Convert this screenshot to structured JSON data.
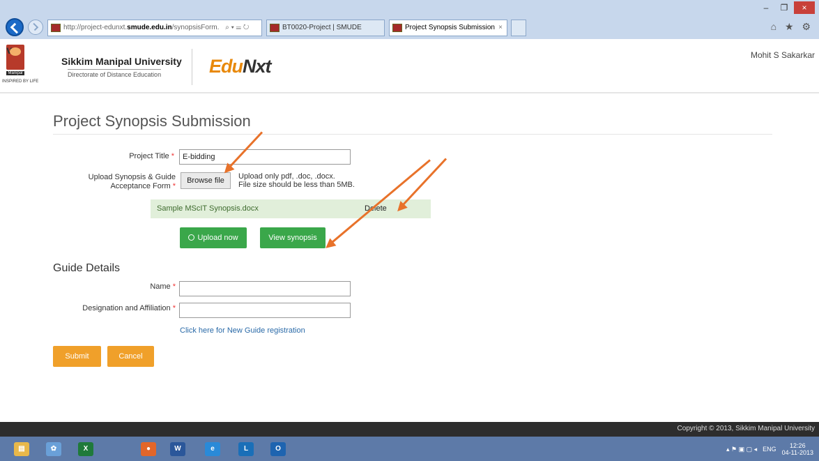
{
  "browser": {
    "address_prefix": "http://project-edunxt.",
    "address_host": "smude.edu.in",
    "address_suffix": "/synopsisForm.",
    "address_controls": "⌕ ▾ ☰ ↻",
    "tabs": [
      {
        "label": "BT0020-Project | SMUDE"
      },
      {
        "label": "Project Synopsis Submission"
      }
    ],
    "tab_close": "×",
    "window_minimize": "–",
    "window_restore": "❐",
    "window_close": "×",
    "toolbar_icons": "⌂ ★ ⚙"
  },
  "header": {
    "logo_label": "Manipal",
    "tagline": "INSPIRED BY LIFE",
    "university": "Sikkim Manipal University",
    "subtitle": "Directorate of Distance Education",
    "brand_prefix": "Edu",
    "brand_suffix": "Nxt",
    "user": "Mohit S Sakarkar"
  },
  "form": {
    "page_title": "Project Synopsis Submission",
    "project_title_label": "Project Title",
    "project_title_value": "E-bidding",
    "upload_label_line1": "Upload Synopsis & Guide",
    "upload_label_line2": "Acceptance Form",
    "required_mark": "*",
    "browse_label": "Browse file",
    "upload_note_line1": "Upload only pdf, .doc, .docx.",
    "upload_note_line2": "File size should be less than 5MB.",
    "file_name": "Sample MScIT Synopsis.docx",
    "delete_label": "Delete",
    "upload_now_label": "Upload now",
    "view_synopsis_label": "View synopsis",
    "guide_section_title": "Guide Details",
    "name_label": "Name",
    "designation_label": "Designation and Affiliation",
    "new_guide_link": "Click here for New Guide registration",
    "submit_label": "Submit",
    "cancel_label": "Cancel"
  },
  "footer": {
    "copyright": "Copyright © 2013, Sikkim Manipal University"
  },
  "taskbar": {
    "apps": [
      {
        "icon": "file-explorer-icon",
        "glyph": "▤",
        "color": "#e8b84a"
      },
      {
        "icon": "paint-icon",
        "glyph": "✿",
        "color": "#6aa0d8"
      },
      {
        "icon": "excel-icon",
        "glyph": "X",
        "color": "#1f7a3a"
      },
      {
        "icon": "firefox-icon",
        "glyph": "●",
        "color": "#e2662a"
      },
      {
        "icon": "word-icon",
        "glyph": "W",
        "color": "#2b579a"
      },
      {
        "icon": "internet-explorer-icon",
        "glyph": "e",
        "color": "#2a8ad8"
      },
      {
        "icon": "lync-icon",
        "glyph": "L",
        "color": "#1a6fb8"
      },
      {
        "icon": "outlook-icon",
        "glyph": "O",
        "color": "#1e64b0"
      }
    ],
    "tray_icons": "▴ ⚑ ▣ ▢ ◂",
    "language": "ENG",
    "time": "12:26",
    "date": "04-11-2013"
  },
  "colors": {
    "accent_green": "#3aa74a",
    "accent_orange": "#f0a02a",
    "annotation_arrow": "#e8722a",
    "link_blue": "#2a6aa8",
    "brand_orange": "#e8890c"
  }
}
